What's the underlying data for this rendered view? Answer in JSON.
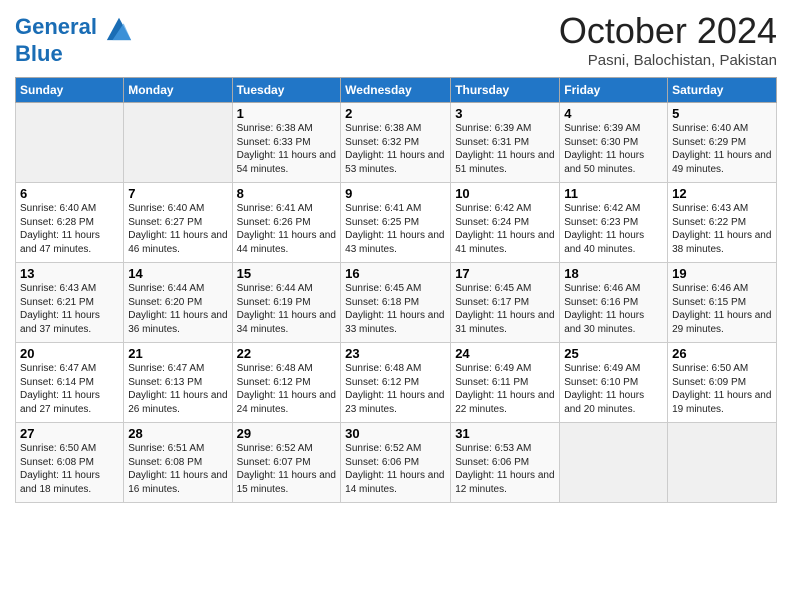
{
  "header": {
    "logo_line1": "General",
    "logo_line2": "Blue",
    "month": "October 2024",
    "location": "Pasni, Balochistan, Pakistan"
  },
  "days_of_week": [
    "Sunday",
    "Monday",
    "Tuesday",
    "Wednesday",
    "Thursday",
    "Friday",
    "Saturday"
  ],
  "weeks": [
    [
      {
        "day": "",
        "info": ""
      },
      {
        "day": "",
        "info": ""
      },
      {
        "day": "1",
        "info": "Sunrise: 6:38 AM\nSunset: 6:33 PM\nDaylight: 11 hours and 54 minutes."
      },
      {
        "day": "2",
        "info": "Sunrise: 6:38 AM\nSunset: 6:32 PM\nDaylight: 11 hours and 53 minutes."
      },
      {
        "day": "3",
        "info": "Sunrise: 6:39 AM\nSunset: 6:31 PM\nDaylight: 11 hours and 51 minutes."
      },
      {
        "day": "4",
        "info": "Sunrise: 6:39 AM\nSunset: 6:30 PM\nDaylight: 11 hours and 50 minutes."
      },
      {
        "day": "5",
        "info": "Sunrise: 6:40 AM\nSunset: 6:29 PM\nDaylight: 11 hours and 49 minutes."
      }
    ],
    [
      {
        "day": "6",
        "info": "Sunrise: 6:40 AM\nSunset: 6:28 PM\nDaylight: 11 hours and 47 minutes."
      },
      {
        "day": "7",
        "info": "Sunrise: 6:40 AM\nSunset: 6:27 PM\nDaylight: 11 hours and 46 minutes."
      },
      {
        "day": "8",
        "info": "Sunrise: 6:41 AM\nSunset: 6:26 PM\nDaylight: 11 hours and 44 minutes."
      },
      {
        "day": "9",
        "info": "Sunrise: 6:41 AM\nSunset: 6:25 PM\nDaylight: 11 hours and 43 minutes."
      },
      {
        "day": "10",
        "info": "Sunrise: 6:42 AM\nSunset: 6:24 PM\nDaylight: 11 hours and 41 minutes."
      },
      {
        "day": "11",
        "info": "Sunrise: 6:42 AM\nSunset: 6:23 PM\nDaylight: 11 hours and 40 minutes."
      },
      {
        "day": "12",
        "info": "Sunrise: 6:43 AM\nSunset: 6:22 PM\nDaylight: 11 hours and 38 minutes."
      }
    ],
    [
      {
        "day": "13",
        "info": "Sunrise: 6:43 AM\nSunset: 6:21 PM\nDaylight: 11 hours and 37 minutes."
      },
      {
        "day": "14",
        "info": "Sunrise: 6:44 AM\nSunset: 6:20 PM\nDaylight: 11 hours and 36 minutes."
      },
      {
        "day": "15",
        "info": "Sunrise: 6:44 AM\nSunset: 6:19 PM\nDaylight: 11 hours and 34 minutes."
      },
      {
        "day": "16",
        "info": "Sunrise: 6:45 AM\nSunset: 6:18 PM\nDaylight: 11 hours and 33 minutes."
      },
      {
        "day": "17",
        "info": "Sunrise: 6:45 AM\nSunset: 6:17 PM\nDaylight: 11 hours and 31 minutes."
      },
      {
        "day": "18",
        "info": "Sunrise: 6:46 AM\nSunset: 6:16 PM\nDaylight: 11 hours and 30 minutes."
      },
      {
        "day": "19",
        "info": "Sunrise: 6:46 AM\nSunset: 6:15 PM\nDaylight: 11 hours and 29 minutes."
      }
    ],
    [
      {
        "day": "20",
        "info": "Sunrise: 6:47 AM\nSunset: 6:14 PM\nDaylight: 11 hours and 27 minutes."
      },
      {
        "day": "21",
        "info": "Sunrise: 6:47 AM\nSunset: 6:13 PM\nDaylight: 11 hours and 26 minutes."
      },
      {
        "day": "22",
        "info": "Sunrise: 6:48 AM\nSunset: 6:12 PM\nDaylight: 11 hours and 24 minutes."
      },
      {
        "day": "23",
        "info": "Sunrise: 6:48 AM\nSunset: 6:12 PM\nDaylight: 11 hours and 23 minutes."
      },
      {
        "day": "24",
        "info": "Sunrise: 6:49 AM\nSunset: 6:11 PM\nDaylight: 11 hours and 22 minutes."
      },
      {
        "day": "25",
        "info": "Sunrise: 6:49 AM\nSunset: 6:10 PM\nDaylight: 11 hours and 20 minutes."
      },
      {
        "day": "26",
        "info": "Sunrise: 6:50 AM\nSunset: 6:09 PM\nDaylight: 11 hours and 19 minutes."
      }
    ],
    [
      {
        "day": "27",
        "info": "Sunrise: 6:50 AM\nSunset: 6:08 PM\nDaylight: 11 hours and 18 minutes."
      },
      {
        "day": "28",
        "info": "Sunrise: 6:51 AM\nSunset: 6:08 PM\nDaylight: 11 hours and 16 minutes."
      },
      {
        "day": "29",
        "info": "Sunrise: 6:52 AM\nSunset: 6:07 PM\nDaylight: 11 hours and 15 minutes."
      },
      {
        "day": "30",
        "info": "Sunrise: 6:52 AM\nSunset: 6:06 PM\nDaylight: 11 hours and 14 minutes."
      },
      {
        "day": "31",
        "info": "Sunrise: 6:53 AM\nSunset: 6:06 PM\nDaylight: 11 hours and 12 minutes."
      },
      {
        "day": "",
        "info": ""
      },
      {
        "day": "",
        "info": ""
      }
    ]
  ]
}
